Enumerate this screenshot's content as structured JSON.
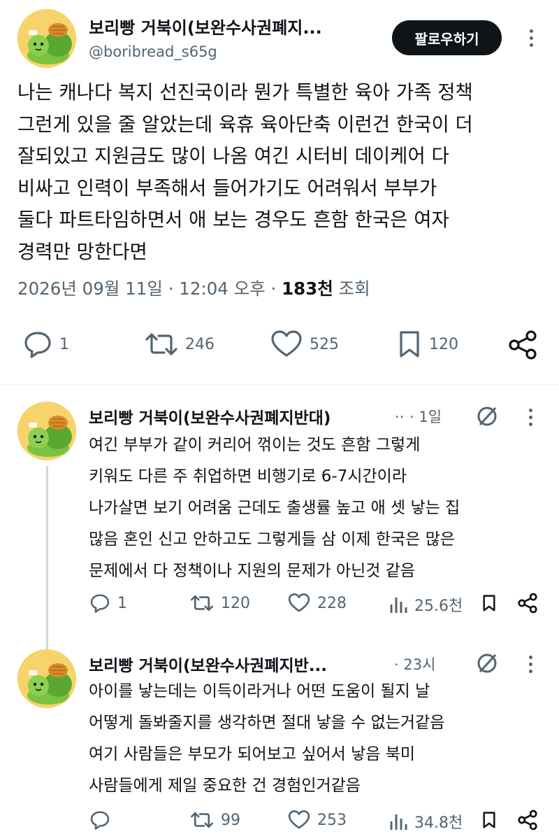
{
  "main_tweet": {
    "author_name": "보리빵 거북이(보완수사권폐지...",
    "handle": "@boribread_s65g",
    "follow_label": "팔로우하기",
    "text_lines": [
      "나는 캐나다 복지 선진국이라 뭔가 특별한 육아 가족 정책",
      "그런게 있을 줄 알았는데 육휴 육아단축 이런건 한국이 더",
      "잘되있고 지원금도 많이 나옴 여긴 시터비 데이케어 다",
      "비싸고 인력이 부족해서 들어가기도 어려워서 부부가",
      "둘다 파트타임하면서 애 보는 경우도 흔함 한국은 여자",
      "경력만 망한다면"
    ],
    "date": "2026년 09월 11일 · 12:04 오후 · ",
    "views_count": "183천",
    "views_label": " 조회",
    "replies": "1",
    "retweets": "246",
    "likes": "525",
    "bookmarks": "120"
  },
  "replies": [
    {
      "author_name": "보리빵 거북이(보완수사권폐지반대)",
      "ellipsis": "..",
      "time": "· 1일",
      "text_lines": [
        "여긴 부부가 같이 커리어 꺾이는 것도 흔함 그렇게",
        "키워도 다른 주 취업하면 비행기로 6-7시간이라",
        "나가살면 보기 어려움 근데도 출생률 높고 애 셋 낳는 집",
        "많음 혼인 신고 안하고도 그렇게들 삼 이제 한국은 많은",
        "문제에서 다 정책이나 지원의 문제가 아닌것 같음"
      ],
      "replies": "1",
      "retweets": "120",
      "likes": "228",
      "views": "25.6천"
    },
    {
      "author_name": "보리빵 거북이(보완수사권폐지반...",
      "ellipsis": "",
      "time": "· 23시",
      "text_lines": [
        "아이를 낳는데는 이득이라거나 어떤 도움이 될지 날",
        "어떻게 돌봐줄지를 생각하면 절대 낳을 수 없는거같음",
        "여기 사람들은 부모가 되어보고 싶어서 낳음 북미",
        "사람들에게 제일 중요한 건 경험인거같음"
      ],
      "replies": "",
      "retweets": "99",
      "likes": "253",
      "views": "34.8천"
    }
  ],
  "colors": {
    "text": "#0f1419",
    "secondary": "#536471",
    "avatar_bg": "#f7d36b",
    "button_bg": "#0f1419"
  }
}
